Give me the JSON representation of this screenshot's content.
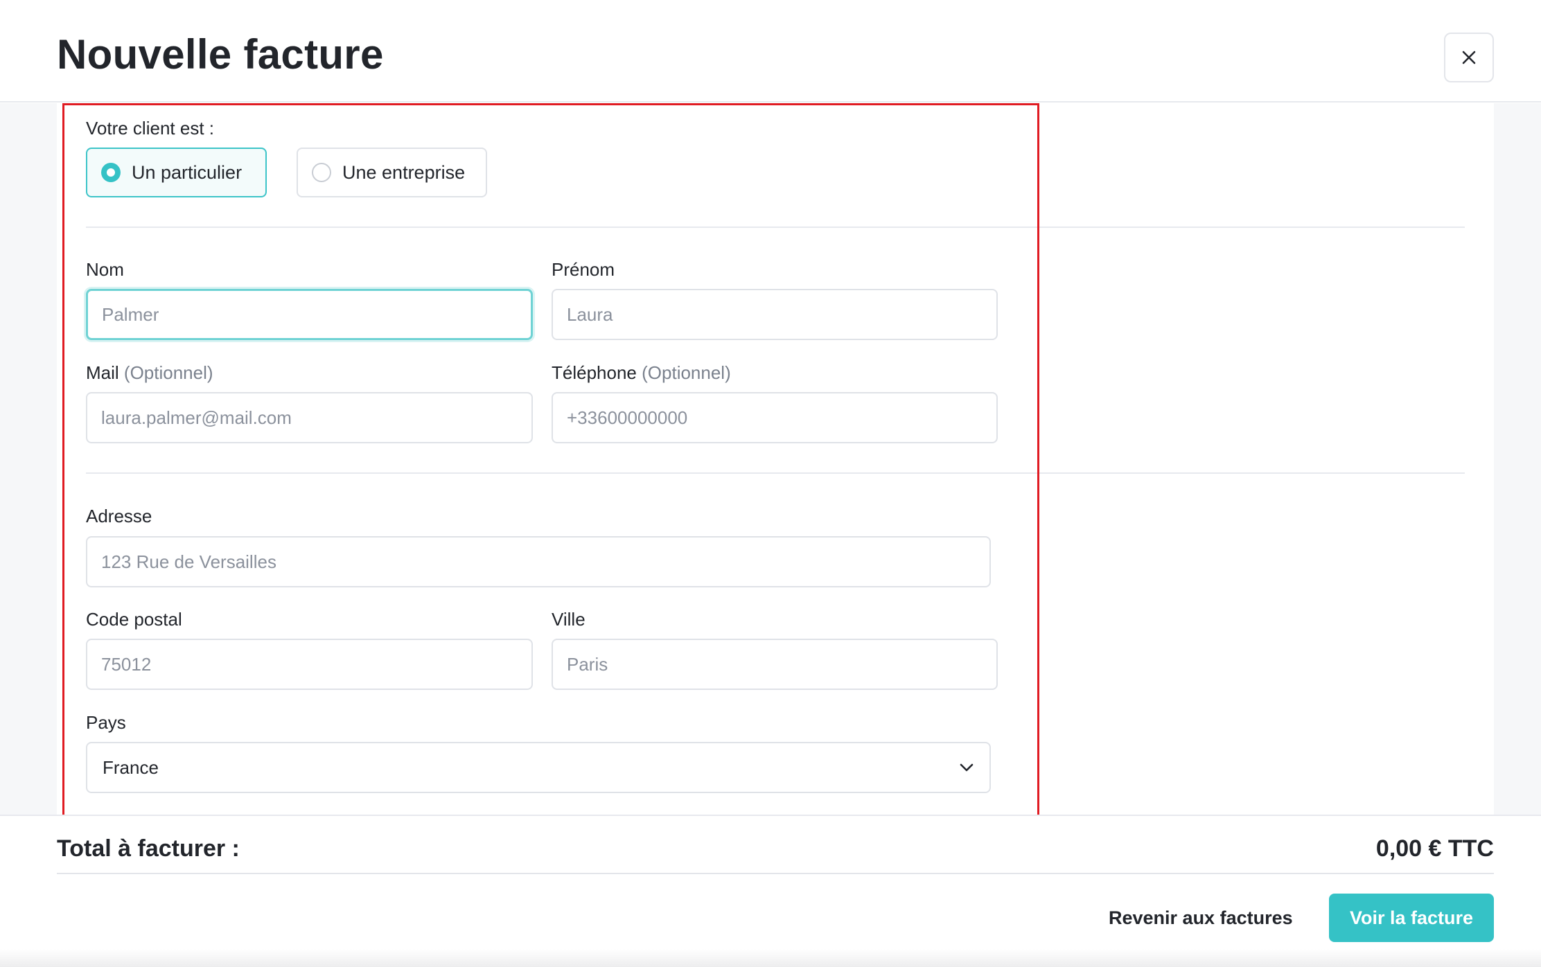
{
  "header": {
    "title": "Nouvelle facture",
    "close_icon": "close-icon"
  },
  "form": {
    "client_type": {
      "label": "Votre client est :",
      "options": [
        {
          "label": "Un particulier",
          "selected": true
        },
        {
          "label": "Une entreprise",
          "selected": false
        }
      ]
    },
    "nom": {
      "label": "Nom",
      "placeholder": "Palmer",
      "value": ""
    },
    "prenom": {
      "label": "Prénom",
      "placeholder": "Laura",
      "value": ""
    },
    "mail": {
      "label": "Mail",
      "optional": "(Optionnel)",
      "placeholder": "laura.palmer@mail.com",
      "value": ""
    },
    "telephone": {
      "label": "Téléphone",
      "optional": "(Optionnel)",
      "placeholder": "+33600000000",
      "value": ""
    },
    "adresse": {
      "label": "Adresse",
      "placeholder": "123 Rue de Versailles",
      "value": ""
    },
    "code_postal": {
      "label": "Code postal",
      "placeholder": "75012",
      "value": ""
    },
    "ville": {
      "label": "Ville",
      "placeholder": "Paris",
      "value": ""
    },
    "pays": {
      "label": "Pays",
      "value": "France",
      "icon": "chevron-down-icon"
    }
  },
  "footer": {
    "total_label": "Total à facturer :",
    "total_value": "0,00 € TTC",
    "back_label": "Revenir aux factures",
    "primary_label": "Voir la facture"
  },
  "colors": {
    "accent": "#35c2c6",
    "highlight_border": "#e01b22",
    "text": "#22252b",
    "muted": "#8b919c"
  }
}
